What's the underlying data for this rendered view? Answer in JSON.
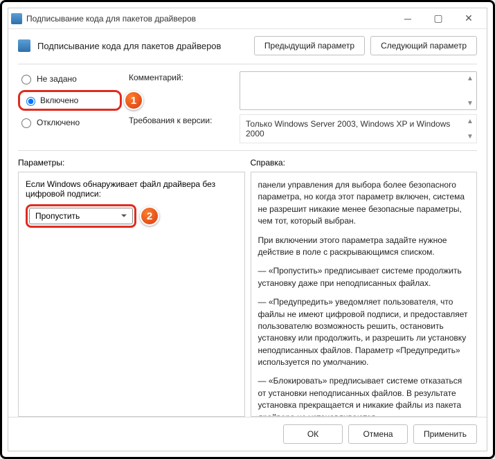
{
  "title": "Подписывание кода для пакетов драйверов",
  "header_title": "Подписывание кода для пакетов драйверов",
  "nav": {
    "prev": "Предыдущий параметр",
    "next": "Следующий параметр"
  },
  "state": {
    "not_configured": "Не задано",
    "enabled": "Включено",
    "disabled": "Отключено"
  },
  "labels": {
    "comment": "Комментарий:",
    "requirements": "Требования к версии:",
    "options": "Параметры:",
    "help": "Справка:"
  },
  "requirements_text": "Только Windows Server 2003, Windows XP и Windows 2000",
  "options_block": {
    "prompt": "Если Windows обнаруживает файл драйвера без цифровой подписи:",
    "selected": "Пропустить"
  },
  "help_paragraphs": [
    "панели управления для выбора более безопасного параметра, но когда этот параметр включен, система не разрешит никакие менее безопасные параметры, чем тот, который выбран.",
    "При включении этого параметра задайте нужное действие в поле с раскрывающимся списком.",
    "—   «Пропустить» предписывает системе продолжить установку даже при неподписанных файлах.",
    "—   «Предупредить» уведомляет пользователя, что файлы не имеют цифровой подписи, и предоставляет пользователю возможность решить, остановить установку или продолжить, и разрешить ли установку неподписанных файлов. Параметр «Предупредить» используется по умолчанию.",
    "—   «Блокировать» предписывает системе отказаться от установки неподписанных файлов. В результате установка прекращается и никакие файлы из пакета драйвера не устанавливаются"
  ],
  "footer": {
    "ok": "ОК",
    "cancel": "Отмена",
    "apply": "Применить"
  },
  "markers": {
    "one": "1",
    "two": "2"
  }
}
